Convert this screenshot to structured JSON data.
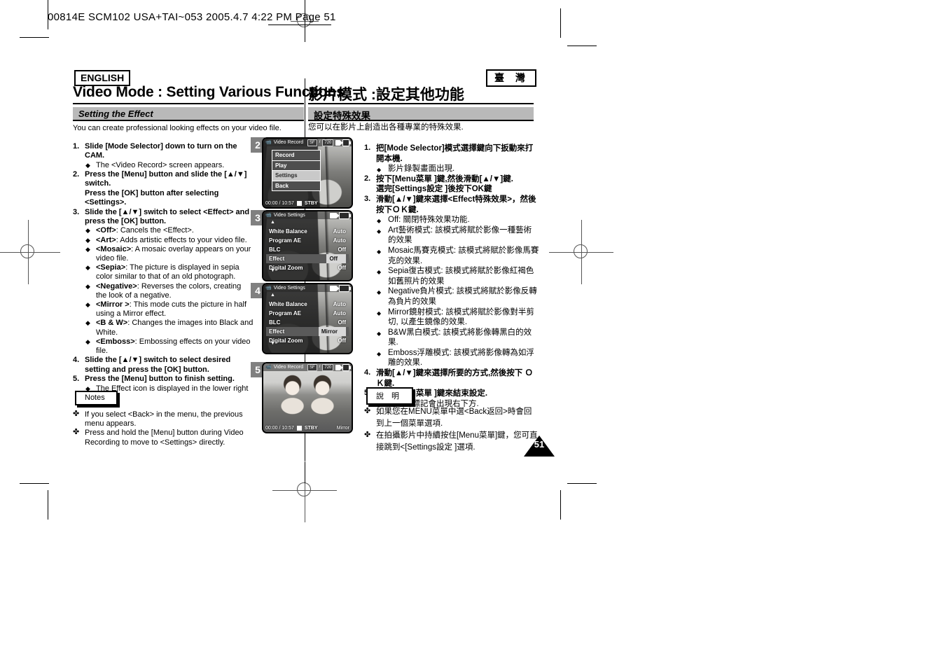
{
  "slug": {
    "line": "00814E SCM102 USA+TAI~053  2005.4.7  4:22 PM  Page 51"
  },
  "header": {
    "english_badge": "ENGLISH",
    "taiwan_badge": "臺 灣",
    "title_en": "Video Mode : Setting Various Functions",
    "title_cn": "影片模式 :設定其他功能"
  },
  "section": {
    "title_en": "Setting the Effect",
    "title_cn": "設定特殊效果",
    "intro_en": "You can create professional looking effects on your video file.",
    "intro_cn": "您可以在影片上創造出各種專業的特殊效果."
  },
  "steps_en": [
    {
      "num": "1.",
      "text": "Slide [Mode Selector] down to turn on the CAM.",
      "bullets": [
        {
          "label": "",
          "text": "The <Video Record> screen appears."
        }
      ]
    },
    {
      "num": "2.",
      "text": "Press the [Menu] button and slide the [▲/▼] switch.",
      "text2": "Press the [OK] button after selecting <Settings>.",
      "bullets": []
    },
    {
      "num": "3.",
      "text": "Slide the [▲/▼] switch to select <Effect> and press the [OK] button.",
      "bullets": [
        {
          "label": "<Off>",
          "text": ": Cancels the <Effect>."
        },
        {
          "label": "<Art>",
          "text": ": Adds artistic effects to your video file."
        },
        {
          "label": "<Mosaic>",
          "text": ": A mosaic overlay appears on your video file."
        },
        {
          "label": "<Sepia>",
          "text": ": The picture is displayed in sepia color similar to that of an old photograph."
        },
        {
          "label": "<Negative>",
          "text": ": Reverses the colors, creating the look of a negative."
        },
        {
          "label": "<Mirror >",
          "text": ": This mode cuts the picture in half using a Mirror effect."
        },
        {
          "label": "<B & W>",
          "text": ": Changes the images into Black and White."
        },
        {
          "label": "<Emboss>",
          "text": ": Embossing effects on your video file."
        }
      ]
    },
    {
      "num": "4.",
      "text": "Slide the [▲/▼] switch to select desired setting and press the [OK] button.",
      "bullets": []
    },
    {
      "num": "5.",
      "text": "Press the [Menu] button to finish setting.",
      "bullets": [
        {
          "label": "",
          "text": "The Effect icon is displayed in the lower right corner."
        }
      ]
    }
  ],
  "steps_cn": [
    {
      "num": "1.",
      "text": "把[Mode Selector]模式選擇鍵向下扳動來打開本機.",
      "bullets": [
        {
          "label": "",
          "text": "影片錄製畫面出現."
        }
      ]
    },
    {
      "num": "2.",
      "text": "按下[Menu菜單 ]鍵,然後滑動[▲/▼]鍵.",
      "text2": "選完[Settings設定 ]後按下OK鍵",
      "bullets": []
    },
    {
      "num": "3.",
      "text": "滑動[▲/▼]鍵來選擇<Effect特殊效果>，然後按下ＯＫ鍵.",
      "bullets": [
        {
          "label": "",
          "text": "Off: 關閉特殊效果功能."
        },
        {
          "label": "",
          "text": "Art藝術模式: 該模式將賦於影像一種藝術的效果"
        },
        {
          "label": "",
          "text": "Mosaic馬賽克模式: 該模式將賦於影像馬賽克的效果."
        },
        {
          "label": "",
          "text": "Sepia復古模式: 該模式將賦於影像紅褐色如舊照片的效果"
        },
        {
          "label": "",
          "text": "Negative負片模式: 該模式將賦於影像反轉為負片的效果"
        },
        {
          "label": "",
          "text": "Mirror鏡射模式: 該模式將賦於影像對半剪切, 以產生鏡像的效果."
        },
        {
          "label": "",
          "text": "B&W黑白模式: 該模式將影像轉黑白的效果."
        },
        {
          "label": "",
          "text": "Emboss浮雕模式: 該模式將影像轉為如浮雕的效果."
        }
      ]
    },
    {
      "num": "4.",
      "text": "滑動[▲/▼]鍵來選擇所要的方式,然後按下 ＯＫ鍵.",
      "bullets": []
    },
    {
      "num": "5.",
      "text": "按下[Menu菜單 ]鍵來結束設定.",
      "bullets": [
        {
          "label": "",
          "text": "特效的標記會出現右下方."
        }
      ]
    }
  ],
  "notes_en": {
    "title": "Notes",
    "items": [
      "If you select <Back> in the menu, the previous menu appears.",
      "Press and hold the [Menu] button during Video Recording to move to <Settings> directly."
    ]
  },
  "notes_cn": {
    "title": "說 明",
    "items": [
      "如果您在MENU菜單中選<Back返回>時會回到上一個菜單選項.",
      "在拍攝影片中持續按住[Menu菜單]鍵，您可直接跳到<[Settings設定 ]選項."
    ]
  },
  "screens": [
    {
      "step": "2",
      "type": "menu",
      "titlebar": "Video Record",
      "badges": [
        "SF",
        "720"
      ],
      "timecode": "00:00 / 10:57",
      "status": "STBY",
      "menu_items": [
        {
          "label": "Record",
          "selected": false
        },
        {
          "label": "Play",
          "selected": false
        },
        {
          "label": "Settings",
          "selected": true
        },
        {
          "label": "Back",
          "selected": false
        }
      ]
    },
    {
      "step": "3",
      "type": "settings",
      "titlebar": "Video Settings",
      "rows": [
        {
          "key": "White Balance",
          "value": "Auto",
          "selected": false
        },
        {
          "key": "Program AE",
          "value": "Auto",
          "selected": false
        },
        {
          "key": "BLC",
          "value": "Off",
          "selected": false
        },
        {
          "key": "Effect",
          "value": "Off",
          "selected": true
        },
        {
          "key": "Digital Zoom",
          "value": "Off",
          "selected": false
        }
      ]
    },
    {
      "step": "4",
      "type": "settings",
      "titlebar": "Video Settings",
      "rows": [
        {
          "key": "White Balance",
          "value": "Auto",
          "selected": false
        },
        {
          "key": "Program AE",
          "value": "Auto",
          "selected": false
        },
        {
          "key": "BLC",
          "value": "Off",
          "selected": false
        },
        {
          "key": "Effect",
          "value": "Mirror",
          "selected": true
        },
        {
          "key": "Digital Zoom",
          "value": "Off",
          "selected": false
        }
      ]
    },
    {
      "step": "5",
      "type": "preview",
      "titlebar": "Video Record",
      "badges": [
        "SF",
        "720"
      ],
      "timecode": "00:00 / 10:57",
      "status": "STBY",
      "effect_label": "Mirror"
    }
  ],
  "page_number": "51",
  "colors": {
    "section_bar": "#b9b9b9",
    "step_badge": "#808080",
    "ink": "#000000"
  }
}
